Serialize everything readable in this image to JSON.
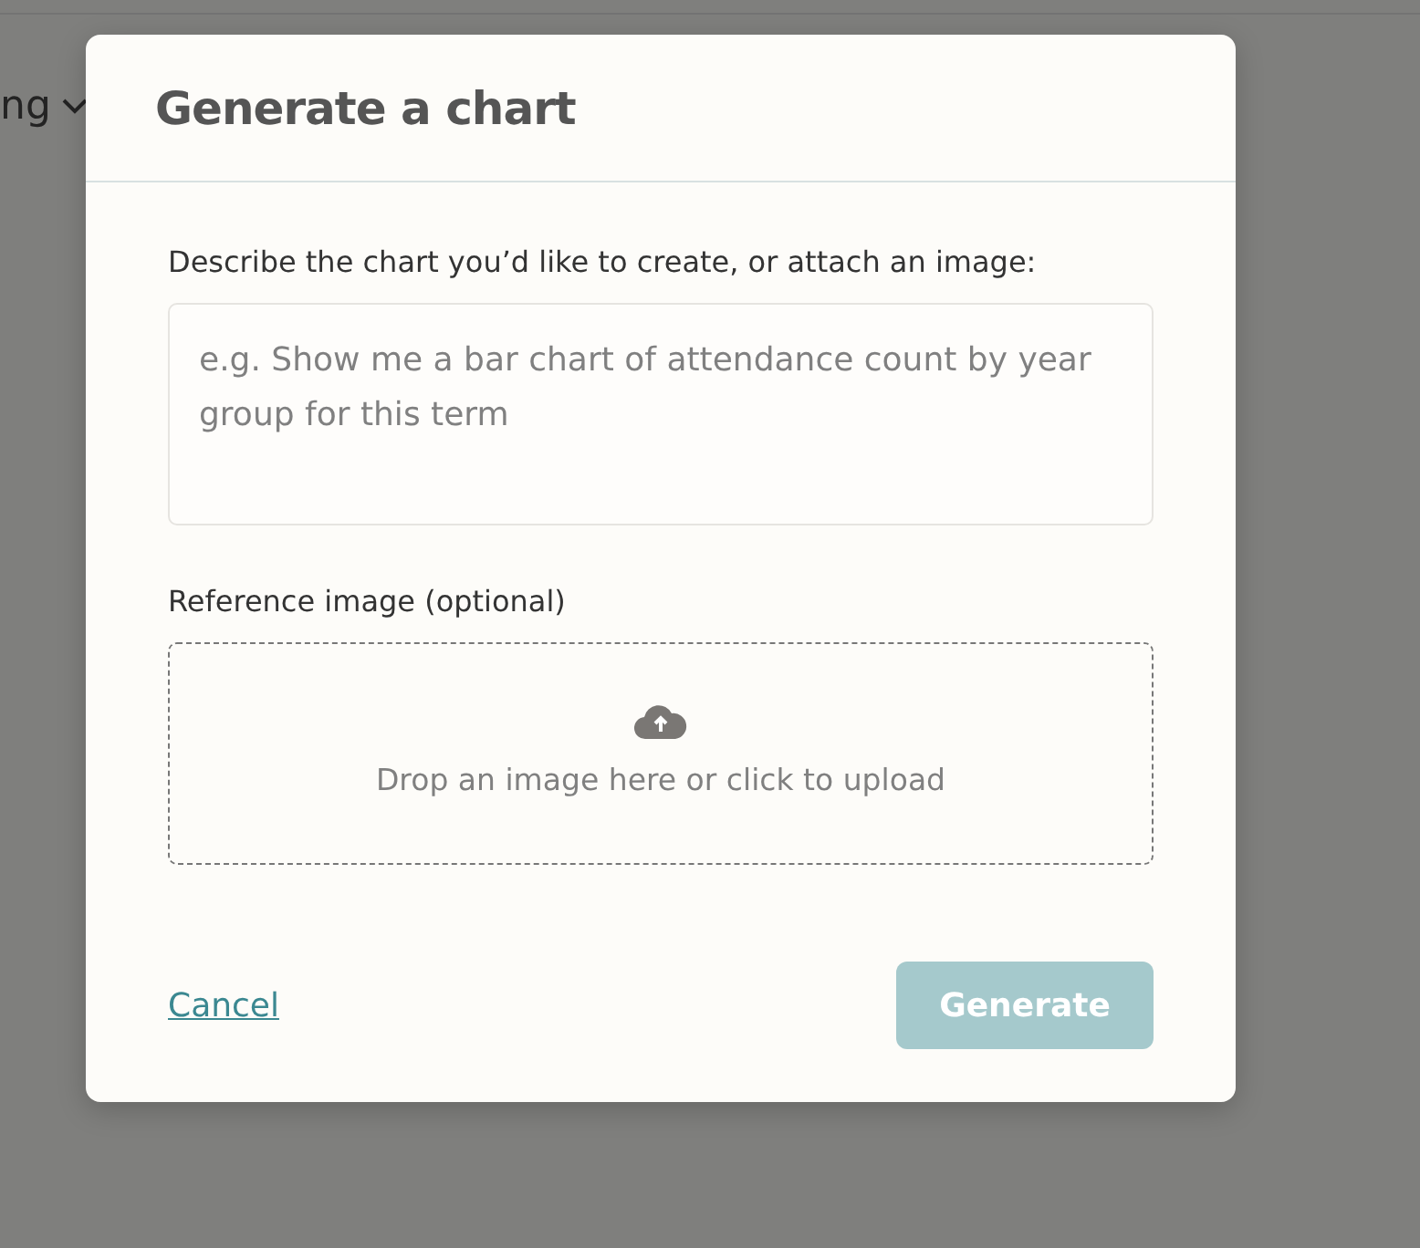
{
  "background": {
    "menu_label": "ng"
  },
  "dialog": {
    "title": "Generate a chart",
    "prompt": {
      "label": "Describe the chart you’d like to create, or attach an image:",
      "placeholder": "e.g. Show me a bar chart of attendance count by year group for this term"
    },
    "reference": {
      "label": "Reference image (optional)",
      "drop_text": "Drop an image here or click to upload"
    },
    "cancel": "Cancel",
    "generate": {
      "label": "Generate",
      "disabled": true
    }
  }
}
